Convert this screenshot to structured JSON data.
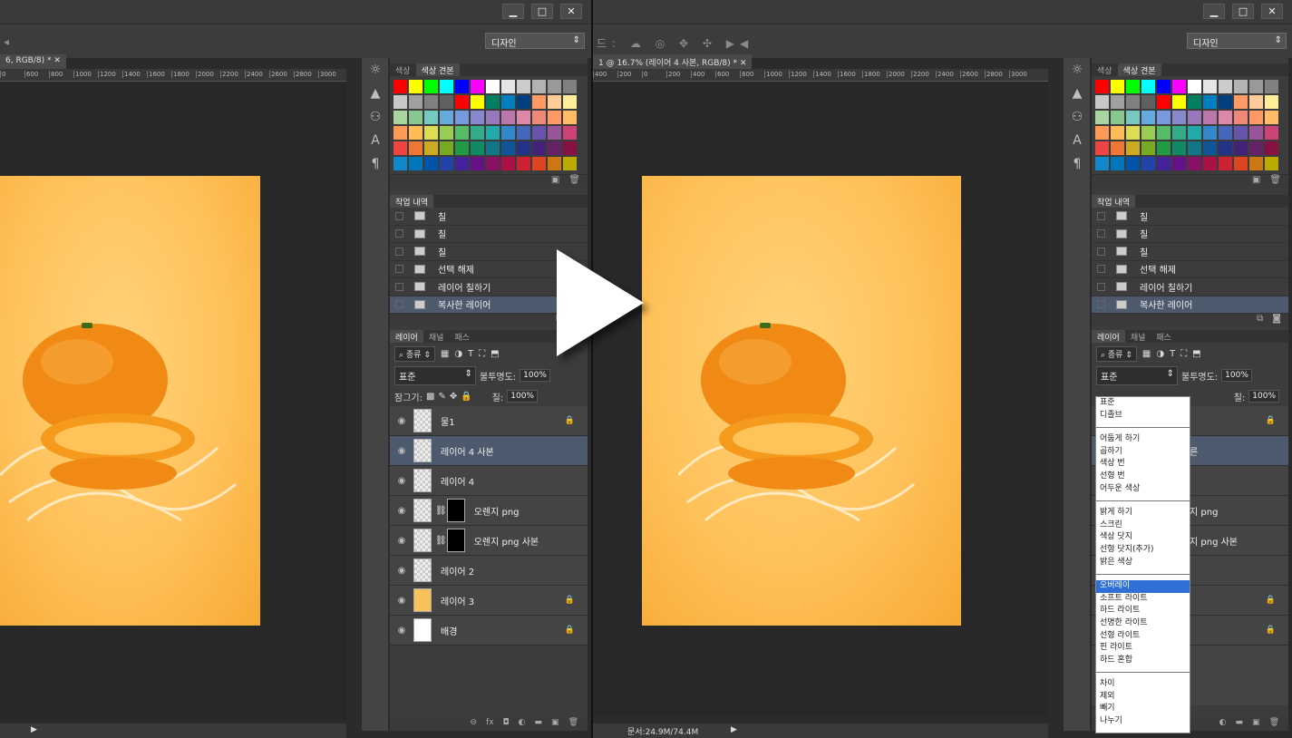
{
  "window": {
    "buttons": [
      "▁",
      "□",
      "✕"
    ]
  },
  "options_bar": {
    "workspace": "디자인",
    "partial_label": "드:"
  },
  "left": {
    "doc_tab": "6, RGB/8) *",
    "ruler_ticks": [
      "0",
      "600",
      "800",
      "1000",
      "1200",
      "1400",
      "1600",
      "1800",
      "2000",
      "2200",
      "2400",
      "2600",
      "2800",
      "3000"
    ]
  },
  "right": {
    "doc_tab": "1 @ 16.7% (레이어 4 사본, RGB/8) *",
    "ruler_ticks": [
      "400",
      "200",
      "0",
      "200",
      "400",
      "600",
      "800",
      "1000",
      "1200",
      "1400",
      "1600",
      "1800",
      "2000",
      "2200",
      "2400",
      "2600",
      "2800",
      "3000"
    ],
    "status": "문서:24.9M/74.4M"
  },
  "swatch_panel": {
    "tabs": [
      "색상",
      "색상 견본"
    ],
    "colors": [
      "#ff0000",
      "#ffff00",
      "#00ff00",
      "#00ffff",
      "#0000ff",
      "#ff00ff",
      "#ffffff",
      "#e6e6e6",
      "#cccccc",
      "#b3b3b3",
      "#999999",
      "#808080",
      "#c8c8c8",
      "#a0a0a0",
      "#808080",
      "#606060",
      "#ff0000",
      "#ffff00",
      "#008060",
      "#0080c0",
      "#004080",
      "#ff9966",
      "#ffcc99",
      "#ffee99",
      "#aad4a0",
      "#88c890",
      "#77c8c0",
      "#66aadd",
      "#7799dd",
      "#8888cc",
      "#9977bb",
      "#bb77aa",
      "#dd88aa",
      "#ee8877",
      "#ff9966",
      "#ffbb66",
      "#ff9955",
      "#ffbb55",
      "#dddd55",
      "#99cc55",
      "#55bb66",
      "#33aa88",
      "#22aaaa",
      "#3388cc",
      "#4466bb",
      "#6655aa",
      "#995599",
      "#cc4477",
      "#ee4444",
      "#ee7733",
      "#ccaa22",
      "#77aa22",
      "#229944",
      "#118866",
      "#117788",
      "#115599",
      "#223388",
      "#442277",
      "#662266",
      "#881144",
      "#1188cc",
      "#0077bb",
      "#0055aa",
      "#2244aa",
      "#442299",
      "#661188",
      "#881166",
      "#aa1144",
      "#cc2233",
      "#dd4422",
      "#cc7711",
      "#bbaa00"
    ]
  },
  "history_panel": {
    "title": "작업 내역",
    "items": [
      "칠",
      "칠",
      "칠",
      "선택 해제",
      "레이어 칠하기",
      "복사한 레이어"
    ]
  },
  "layers_panel": {
    "tabs": [
      "레이어",
      "채널",
      "패스"
    ],
    "filter": "종류",
    "blend_mode": "표준",
    "opacity_label": "불투명도:",
    "opacity": "100%",
    "lock_label": "잠그기:",
    "fill_label": "칠:",
    "fill": "100%",
    "layers": [
      {
        "name": "물1",
        "thumb": "checker",
        "locked": true
      },
      {
        "name": "레이어 4 사본",
        "thumb": "checker",
        "selected": true
      },
      {
        "name": "레이어 4",
        "thumb": "checker"
      },
      {
        "name": "오렌지 png",
        "thumb": "checker",
        "mask": true
      },
      {
        "name": "오렌지 png 사본",
        "thumb": "checker",
        "mask": true
      },
      {
        "name": "레이어 2",
        "thumb": "checker"
      },
      {
        "name": "레이어 3",
        "thumb": "solid",
        "locked": true
      },
      {
        "name": "배경",
        "thumb": "white",
        "locked": true
      }
    ],
    "right_partial": [
      "지 png",
      "지 png 사본"
    ]
  },
  "blend_menu": {
    "groups": [
      [
        "표준",
        "디졸브"
      ],
      [
        "어둡게 하기",
        "곱하기",
        "색상 번",
        "선형 번",
        "어두운 색상"
      ],
      [
        "밝게 하기",
        "스크린",
        "색상 닷지",
        "선형 닷지(추가)",
        "밝은 색상"
      ],
      [
        "오버레이",
        "소프트 라이트",
        "하드 라이트",
        "선명한 라이트",
        "선형 라이트",
        "핀 라이트",
        "하드 혼합"
      ],
      [
        "차이",
        "제외",
        "빼기",
        "나누기"
      ]
    ],
    "highlighted": "오버레이"
  }
}
